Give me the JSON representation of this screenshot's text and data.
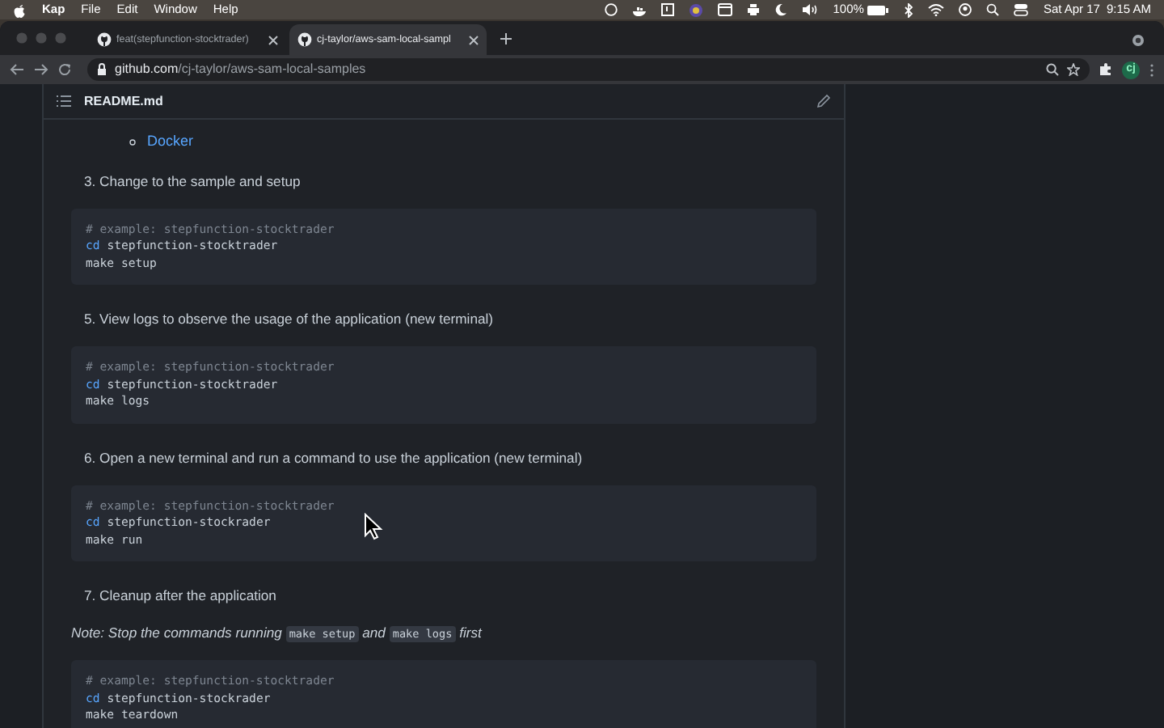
{
  "menu_bar": {
    "app": "Kap",
    "items": [
      "File",
      "Edit",
      "Window",
      "Help"
    ],
    "battery": "100%",
    "date": "Sat Apr 17",
    "time": "9:15 AM"
  },
  "tabs": [
    {
      "label": "feat(stepfunction-stocktrader)",
      "selected": false
    },
    {
      "label": "cj-taylor/aws-sam-local-sampl",
      "selected": true
    }
  ],
  "address": {
    "host": "github.com",
    "path": "/cj-taylor/aws-sam-local-samples"
  },
  "profile": "cj",
  "readme": {
    "title": "README.md",
    "links": [
      "Docker"
    ],
    "blocks": [
      {
        "kind": "step",
        "text": "3. Change to the sample and setup"
      },
      {
        "kind": "code",
        "lines": [
          [
            {
              "kind": "comment",
              "text": "# example: stepfunction-stocktrader"
            }
          ],
          [
            {
              "kind": "keyword",
              "text": "cd"
            },
            {
              "kind": "plain",
              "text": " stepfunction-stocktrader"
            }
          ],
          [
            {
              "kind": "plain",
              "text": "make setup"
            }
          ]
        ]
      },
      {
        "kind": "step",
        "text": "5. View logs to observe the usage of the application (new terminal)"
      },
      {
        "kind": "code",
        "lines": [
          [
            {
              "kind": "comment",
              "text": "# example: stepfunction-stocktrader"
            }
          ],
          [
            {
              "kind": "keyword",
              "text": "cd"
            },
            {
              "kind": "plain",
              "text": " stepfunction-stocktrader"
            }
          ],
          [
            {
              "kind": "plain",
              "text": "make logs"
            }
          ]
        ]
      },
      {
        "kind": "step",
        "text": "6. Open a new terminal and run a command to use the application (new terminal)"
      },
      {
        "kind": "code",
        "lines": [
          [
            {
              "kind": "comment",
              "text": "# example: stepfunction-stocktrader"
            }
          ],
          [
            {
              "kind": "keyword",
              "text": "cd"
            },
            {
              "kind": "plain",
              "text": " stepfunction-stockrader"
            }
          ],
          [
            {
              "kind": "plain",
              "text": "make run"
            }
          ]
        ]
      },
      {
        "kind": "step",
        "text": "7. Cleanup after the application"
      },
      {
        "kind": "note",
        "parts": [
          {
            "kind": "text",
            "text": "Note: Stop the commands running "
          },
          {
            "kind": "code",
            "text": "make setup"
          },
          {
            "kind": "text",
            "text": " and "
          },
          {
            "kind": "code",
            "text": "make logs"
          },
          {
            "kind": "text",
            "text": " first"
          }
        ]
      },
      {
        "kind": "code",
        "lines": [
          [
            {
              "kind": "comment",
              "text": "# example: stepfunction-stocktrader"
            }
          ],
          [
            {
              "kind": "keyword",
              "text": "cd"
            },
            {
              "kind": "plain",
              "text": " stepfunction-stockrader"
            }
          ],
          [
            {
              "kind": "plain",
              "text": "make teardown"
            }
          ]
        ]
      }
    ]
  }
}
